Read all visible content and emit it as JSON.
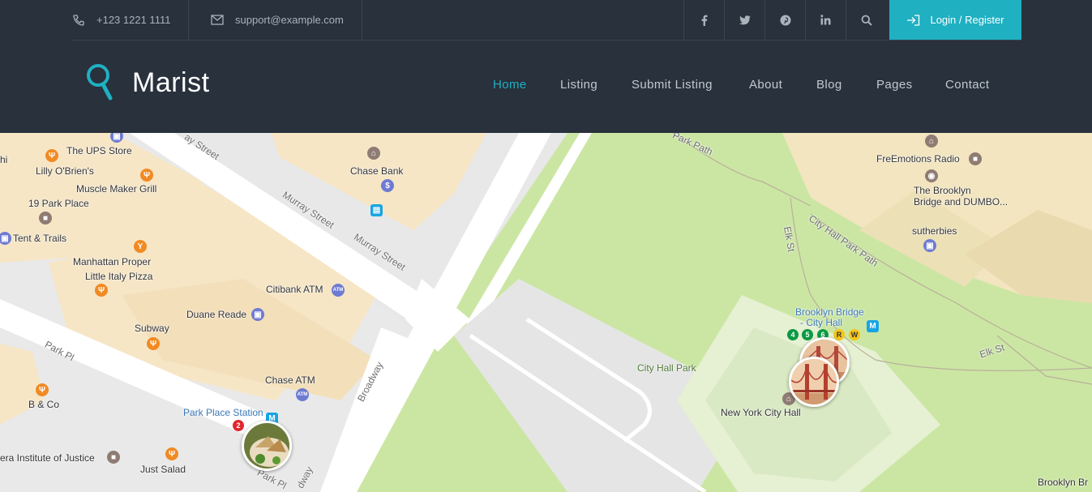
{
  "topbar": {
    "phone": "+123 1221 1111",
    "email": "support@example.com",
    "social": [
      "f",
      "t",
      "p",
      "in",
      "search"
    ],
    "login_label": "Login / Register"
  },
  "brand": {
    "name": "Marist"
  },
  "nav": {
    "items": [
      {
        "label": "Home",
        "active": true
      },
      {
        "label": "Listing",
        "active": false
      },
      {
        "label": "Submit Listing",
        "active": false
      },
      {
        "label": "About",
        "active": false
      },
      {
        "label": "Blog",
        "active": false
      },
      {
        "label": "Pages",
        "active": false
      },
      {
        "label": "Contact",
        "active": false
      }
    ]
  },
  "map": {
    "places": {
      "ups": "The UPS Store",
      "lilly": "Lilly O'Brien's",
      "muscle": "Muscle Maker Grill",
      "park19": "19 Park Place",
      "tent": "Tent & Trails",
      "manhattan": "Manhattan Proper",
      "littleitaly": "Little Italy Pizza",
      "subway": "Subway",
      "chasebank": "Chase Bank",
      "citibank": "Citibank ATM",
      "duane": "Duane Reade",
      "chaseatm": "Chase ATM",
      "parkplace": "Park Place Station",
      "bco": "B & Co",
      "vera": "era Institute of Justice",
      "justsalad": "Just Salad",
      "freemotions": "FreEmotions Radio",
      "brooklynbridge_dumbo": "The Brooklyn\nBridge and DUMBO...",
      "sutherbies": "sutherbies",
      "bbch1": "Brooklyn Bridge",
      "bbch2": "- City Hall",
      "nych": "New York City Hall",
      "cityhallpark": "City Hall Park",
      "brooklynbr": "Brooklyn Br",
      "hi": "hi"
    },
    "streets": {
      "murray1": "Murray Street",
      "murray2": "Murray Street",
      "ay": "ay Street",
      "parkpl": "Park Pl",
      "parkpl2": "Park Pl",
      "broadway": "Broadway",
      "broadway2": "dway",
      "parkrow": "Park Path",
      "cityhallpath": "City Hall Park Path",
      "elk": "Elk St",
      "elk2": "Elk St"
    },
    "subway_lines": [
      "4",
      "5",
      "6",
      "R",
      "W",
      "2"
    ],
    "colors": {
      "park": "#cbe6a3",
      "building": "#f6e6c6",
      "road": "#ffffff",
      "accent": "#1fb0c2"
    }
  }
}
